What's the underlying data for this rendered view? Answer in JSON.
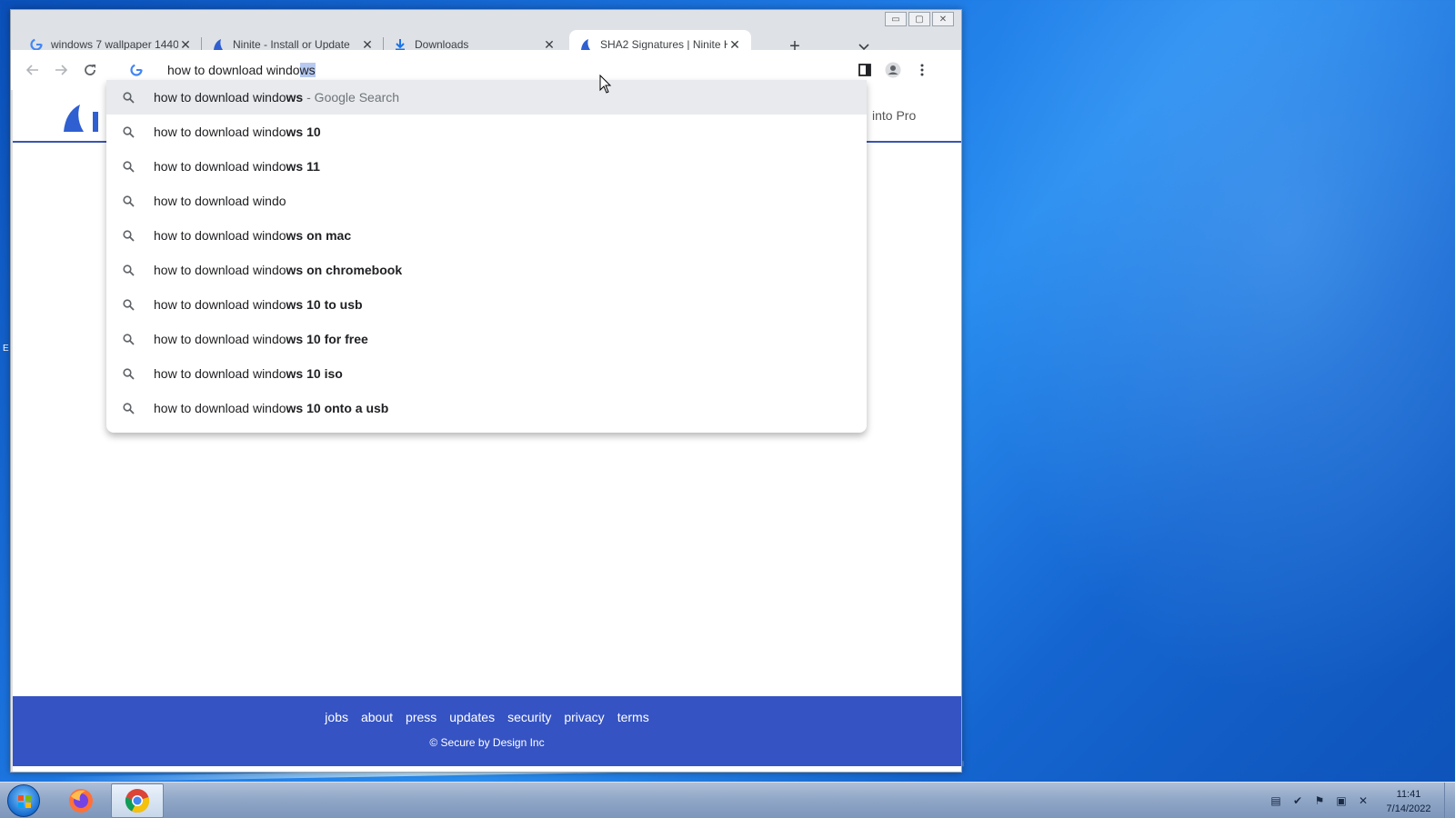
{
  "window_controls": {
    "minimize": "▭",
    "maximize": "▢",
    "close": "✕"
  },
  "tabs": [
    {
      "title": "windows 7 wallpaper 1440",
      "icon": "google-icon",
      "active": false
    },
    {
      "title": "Ninite - Install or Update",
      "icon": "ninite-icon",
      "active": false
    },
    {
      "title": "Downloads",
      "icon": "download-icon",
      "active": false
    },
    {
      "title": "SHA2 Signatures | Ninite H",
      "icon": "ninite-icon",
      "active": true
    }
  ],
  "new_tab_label": "+",
  "omnibox": {
    "typed": "how to download windo",
    "autocomplete": "ws"
  },
  "suggestions": [
    {
      "prefix": "how to download windo",
      "bold": "ws",
      "suffix": " - Google Search",
      "highlighted": true
    },
    {
      "prefix": "how to download windo",
      "bold": "ws 10",
      "suffix": ""
    },
    {
      "prefix": "how to download windo",
      "bold": "ws 11",
      "suffix": ""
    },
    {
      "prefix": "how to download windo",
      "bold": "",
      "suffix": ""
    },
    {
      "prefix": "how to download windo",
      "bold": "ws on mac",
      "suffix": ""
    },
    {
      "prefix": "how to download windo",
      "bold": "ws on chromebook",
      "suffix": ""
    },
    {
      "prefix": "how to download windo",
      "bold": "ws 10 to usb",
      "suffix": ""
    },
    {
      "prefix": "how to download windo",
      "bold": "ws 10 for free",
      "suffix": ""
    },
    {
      "prefix": "how to download windo",
      "bold": "ws 10 iso",
      "suffix": ""
    },
    {
      "prefix": "how to download windo",
      "bold": "ws 10 onto a usb",
      "suffix": ""
    }
  ],
  "page": {
    "header_link": "into Pro",
    "footer_links": [
      "jobs",
      "about",
      "press",
      "updates",
      "security",
      "privacy",
      "terms"
    ],
    "copyright": "© Secure by Design Inc"
  },
  "taskbar": {
    "clock_time": "11:41",
    "clock_date": "7/14/2022"
  },
  "colors": {
    "accent": "#3553c2",
    "tab_strip": "#dee1e6",
    "highlight_row": "#e8eaed"
  }
}
